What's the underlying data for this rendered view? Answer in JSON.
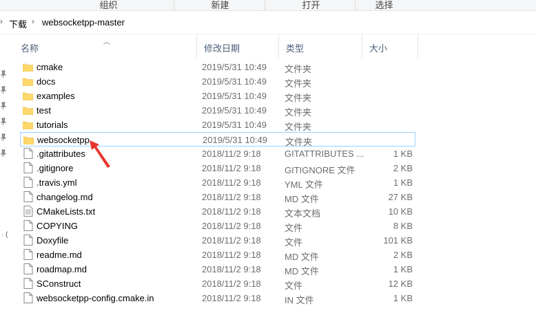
{
  "ribbon": {
    "groups": [
      "组织",
      "新建",
      "打开",
      "选择"
    ]
  },
  "address": {
    "crumbs": [
      "下载",
      "websocketpp-master"
    ]
  },
  "columns": {
    "name": "名称",
    "date": "修改日期",
    "type": "类型",
    "size": "大小"
  },
  "files": [
    {
      "name": "cmake",
      "date": "2019/5/31 10:49",
      "type": "文件夹",
      "size": "",
      "kind": "folder"
    },
    {
      "name": "docs",
      "date": "2019/5/31 10:49",
      "type": "文件夹",
      "size": "",
      "kind": "folder"
    },
    {
      "name": "examples",
      "date": "2019/5/31 10:49",
      "type": "文件夹",
      "size": "",
      "kind": "folder"
    },
    {
      "name": "test",
      "date": "2019/5/31 10:49",
      "type": "文件夹",
      "size": "",
      "kind": "folder"
    },
    {
      "name": "tutorials",
      "date": "2019/5/31 10:49",
      "type": "文件夹",
      "size": "",
      "kind": "folder"
    },
    {
      "name": "websocketpp",
      "date": "2019/5/31 10:49",
      "type": "文件夹",
      "size": "",
      "kind": "folder",
      "selected": true
    },
    {
      "name": ".gitattributes",
      "date": "2018/11/2 9:18",
      "type": "GITATTRIBUTES ...",
      "size": "1 KB",
      "kind": "file"
    },
    {
      "name": ".gitignore",
      "date": "2018/11/2 9:18",
      "type": "GITIGNORE 文件",
      "size": "2 KB",
      "kind": "file"
    },
    {
      "name": ".travis.yml",
      "date": "2018/11/2 9:18",
      "type": "YML 文件",
      "size": "1 KB",
      "kind": "file"
    },
    {
      "name": "changelog.md",
      "date": "2018/11/2 9:18",
      "type": "MD 文件",
      "size": "27 KB",
      "kind": "file"
    },
    {
      "name": "CMakeLists.txt",
      "date": "2018/11/2 9:18",
      "type": "文本文档",
      "size": "10 KB",
      "kind": "text"
    },
    {
      "name": "COPYING",
      "date": "2018/11/2 9:18",
      "type": "文件",
      "size": "8 KB",
      "kind": "file"
    },
    {
      "name": "Doxyfile",
      "date": "2018/11/2 9:18",
      "type": "文件",
      "size": "101 KB",
      "kind": "file"
    },
    {
      "name": "readme.md",
      "date": "2018/11/2 9:18",
      "type": "MD 文件",
      "size": "2 KB",
      "kind": "file"
    },
    {
      "name": "roadmap.md",
      "date": "2018/11/2 9:18",
      "type": "MD 文件",
      "size": "1 KB",
      "kind": "file"
    },
    {
      "name": "SConstruct",
      "date": "2018/11/2 9:18",
      "type": "文件",
      "size": "12 KB",
      "kind": "file"
    },
    {
      "name": "websocketpp-config.cmake.in",
      "date": "2018/11/2 9:18",
      "type": "IN 文件",
      "size": "1 KB",
      "kind": "file"
    }
  ],
  "colors": {
    "header_text": "#4c607a",
    "selection_border": "#99d1ff",
    "folder": "#ffd86b",
    "annotation_arrow": "#e8362f"
  }
}
